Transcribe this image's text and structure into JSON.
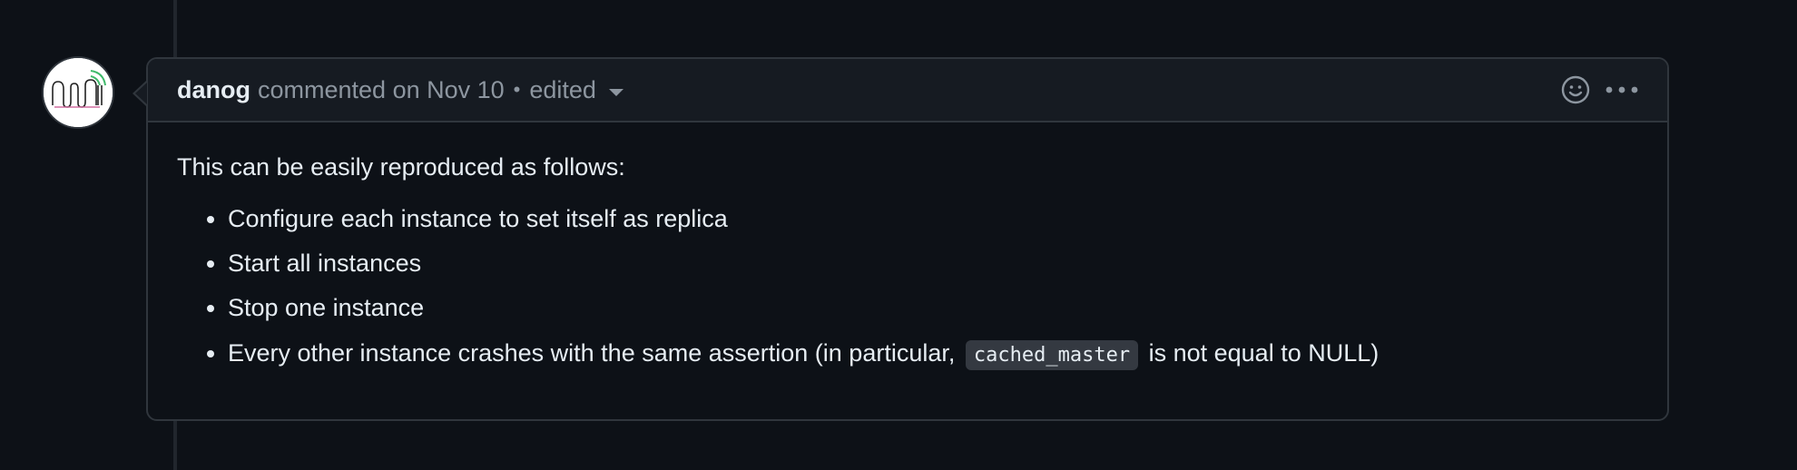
{
  "comment": {
    "author": "danog",
    "action": "commented on Nov 10",
    "separator": "•",
    "edited_label": "edited",
    "header_icons": [
      "smiley-icon",
      "kebab-horizontal-icon"
    ],
    "body": {
      "intro": "This can be easily reproduced as follows:",
      "steps": [
        "Configure each instance to set itself as replica",
        "Start all instances",
        "Stop one instance"
      ],
      "last_step": {
        "before": "Every other instance crashes with the same assertion (in particular,",
        "code": "cached_master",
        "after": "is not equal to NULL)"
      }
    }
  },
  "colors": {
    "background": "#0d1117",
    "header_background": "#161b22",
    "border": "#30363d",
    "text": "#e6edf3",
    "muted": "#8d96a0",
    "code_background": "#343941"
  }
}
